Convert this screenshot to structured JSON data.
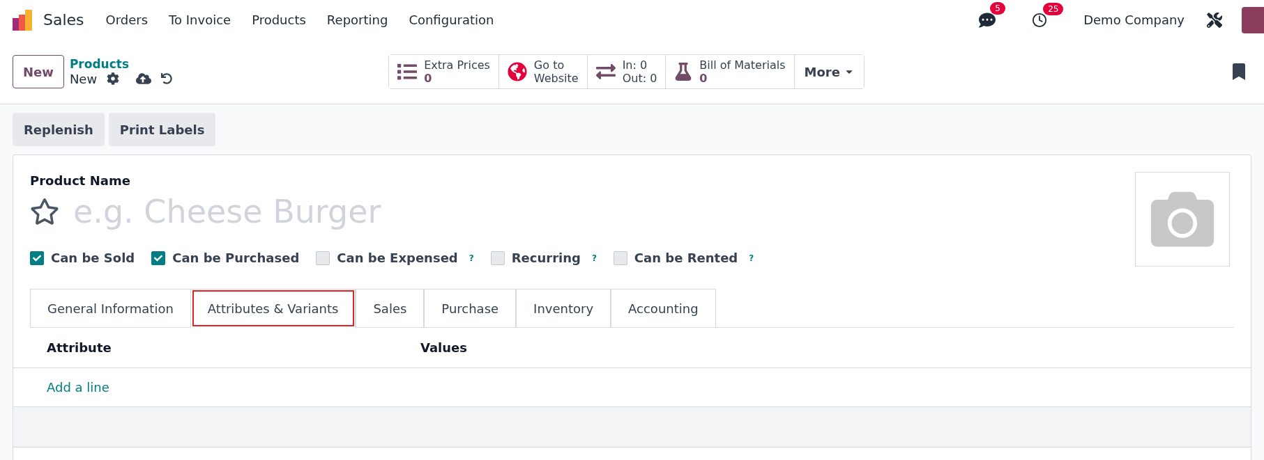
{
  "navbar": {
    "app_name": "Sales",
    "menu": [
      "Orders",
      "To Invoice",
      "Products",
      "Reporting",
      "Configuration"
    ],
    "messages_count": "5",
    "activities_count": "25",
    "company": "Demo Company"
  },
  "control_panel": {
    "new_button": "New",
    "breadcrumb": "Products",
    "record": "New",
    "stat_buttons": [
      {
        "kind": "list",
        "label": "Extra Prices",
        "value": "0"
      },
      {
        "kind": "globe",
        "label": "Go to",
        "value": "Website"
      },
      {
        "kind": "transfer",
        "label": "In: 0",
        "value": "Out: 0"
      },
      {
        "kind": "flask",
        "label": "Bill of Materials",
        "value": "0"
      }
    ],
    "more": "More"
  },
  "action_buttons": [
    "Replenish",
    "Print Labels"
  ],
  "form": {
    "name_label": "Product Name",
    "name_placeholder": "e.g. Cheese Burger",
    "favorite": false,
    "checkboxes": [
      {
        "label": "Can be Sold",
        "checked": true
      },
      {
        "label": "Can be Purchased",
        "checked": true
      },
      {
        "label": "Can be Expensed",
        "checked": false,
        "help": "?"
      },
      {
        "label": "Recurring",
        "checked": false,
        "help": "?"
      },
      {
        "label": "Can be Rented",
        "checked": false,
        "help": "?"
      }
    ],
    "tabs": [
      {
        "label": "General Information",
        "selected": false,
        "highlighted": false
      },
      {
        "label": "Attributes & Variants",
        "selected": true,
        "highlighted": true
      },
      {
        "label": "Sales",
        "selected": false,
        "highlighted": false
      },
      {
        "label": "Purchase",
        "selected": false,
        "highlighted": false
      },
      {
        "label": "Inventory",
        "selected": false,
        "highlighted": false
      },
      {
        "label": "Accounting",
        "selected": false,
        "highlighted": false
      }
    ],
    "table": {
      "columns": [
        "Attribute",
        "Values"
      ],
      "add_line": "Add a line"
    }
  }
}
